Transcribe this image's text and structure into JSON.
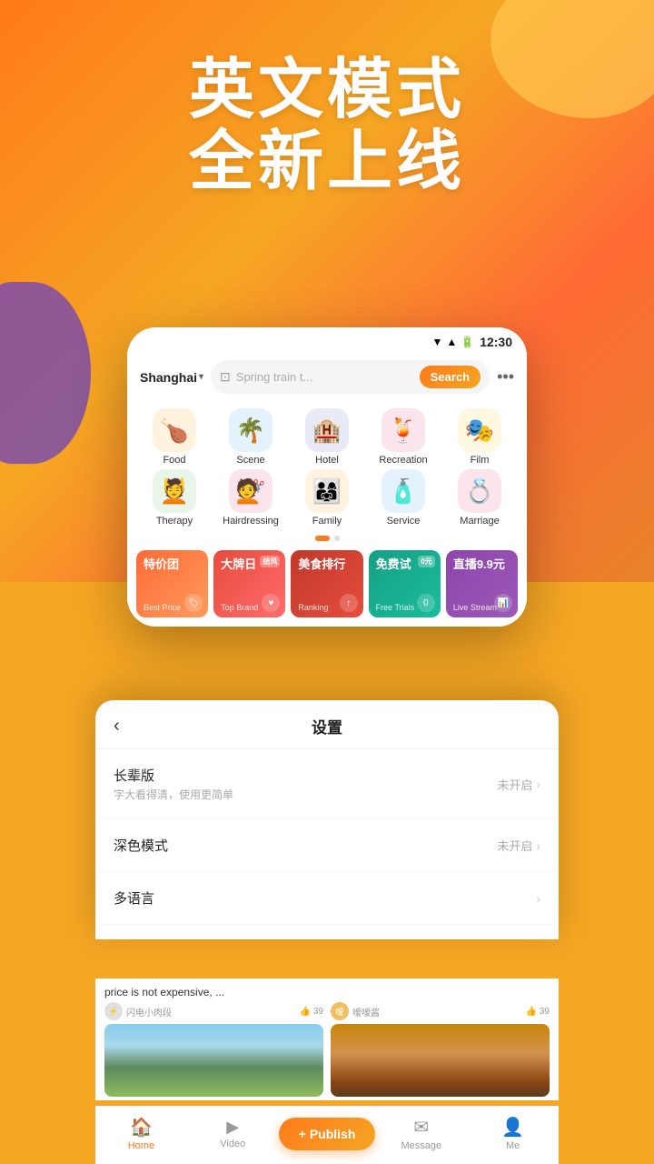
{
  "background": {
    "gradient_start": "#ff7a1a",
    "gradient_end": "#f5a623"
  },
  "hero": {
    "line1": "英文模式",
    "line2": "全新上线"
  },
  "statusBar": {
    "time": "12:30"
  },
  "header": {
    "location": "Shanghai",
    "location_chevron": "▾",
    "search_placeholder": "Spring train t...",
    "search_button": "Search",
    "more_icon": "•••"
  },
  "categories": {
    "row1": [
      {
        "id": "food",
        "label": "Food",
        "emoji": "🍗",
        "bg_class": "icon-food"
      },
      {
        "id": "scene",
        "label": "Scene",
        "emoji": "🌴",
        "bg_class": "icon-scene"
      },
      {
        "id": "hotel",
        "label": "Hotel",
        "emoji": "🏨",
        "bg_class": "icon-hotel"
      },
      {
        "id": "recreation",
        "label": "Recreation",
        "emoji": "🍹",
        "bg_class": "icon-recreation"
      },
      {
        "id": "film",
        "label": "Film",
        "emoji": "🎭",
        "bg_class": "icon-film"
      }
    ],
    "row2": [
      {
        "id": "therapy",
        "label": "Therapy",
        "emoji": "💆",
        "bg_class": "icon-therapy"
      },
      {
        "id": "hairdressing",
        "label": "Hairdressing",
        "emoji": "💇",
        "bg_class": "icon-hairdressing"
      },
      {
        "id": "family",
        "label": "Family",
        "emoji": "👨‍👩‍👧",
        "bg_class": "icon-family"
      },
      {
        "id": "service",
        "label": "Service",
        "emoji": "🧴",
        "bg_class": "icon-service"
      },
      {
        "id": "marriage",
        "label": "Marriage",
        "emoji": "💍",
        "bg_class": "icon-marriage"
      }
    ]
  },
  "promos": [
    {
      "id": "best-price",
      "cn": "特价团",
      "en": "Best Price",
      "color": "orange",
      "badge": ""
    },
    {
      "id": "top-brand",
      "cn": "大牌日",
      "en": "Top Brand",
      "color": "red",
      "badge": "结风"
    },
    {
      "id": "ranking",
      "cn": "美食排行",
      "en": "Ranking",
      "color": "dark-red",
      "badge": ""
    },
    {
      "id": "free-trials",
      "cn": "免费试",
      "en": "Free Trials",
      "color": "teal",
      "badge": "0元"
    },
    {
      "id": "live-stream",
      "cn": "直播9.9元",
      "en": "Live Stream",
      "color": "purple",
      "badge": ""
    }
  ],
  "settings": {
    "title": "设置",
    "back_icon": "‹",
    "items": [
      {
        "id": "elder-mode",
        "main": "长辈版",
        "sub": "字大看得清，使用更简单",
        "status": "未开启"
      },
      {
        "id": "dark-mode",
        "main": "深色模式",
        "sub": "",
        "status": "未开启"
      },
      {
        "id": "language",
        "main": "多语言",
        "sub": "",
        "status": ""
      }
    ],
    "chevron": "›"
  },
  "feed": {
    "items": [
      {
        "id": "feed1",
        "text": "price is not expensive, ...",
        "username": "闪电小肉段",
        "likes": "39"
      },
      {
        "id": "feed2",
        "text": "",
        "username": "嗳嗳酱",
        "likes": "39"
      }
    ]
  },
  "bottomNav": {
    "items": [
      {
        "id": "home",
        "label": "Home",
        "icon": "🏠",
        "active": true
      },
      {
        "id": "video",
        "label": "Video",
        "icon": "▶",
        "active": false
      },
      {
        "id": "publish",
        "label": "Publish",
        "icon": "+",
        "active": false,
        "special": true
      },
      {
        "id": "message",
        "label": "Message",
        "icon": "✉",
        "active": false
      },
      {
        "id": "me",
        "label": "Me",
        "icon": "👤",
        "active": false
      }
    ]
  }
}
